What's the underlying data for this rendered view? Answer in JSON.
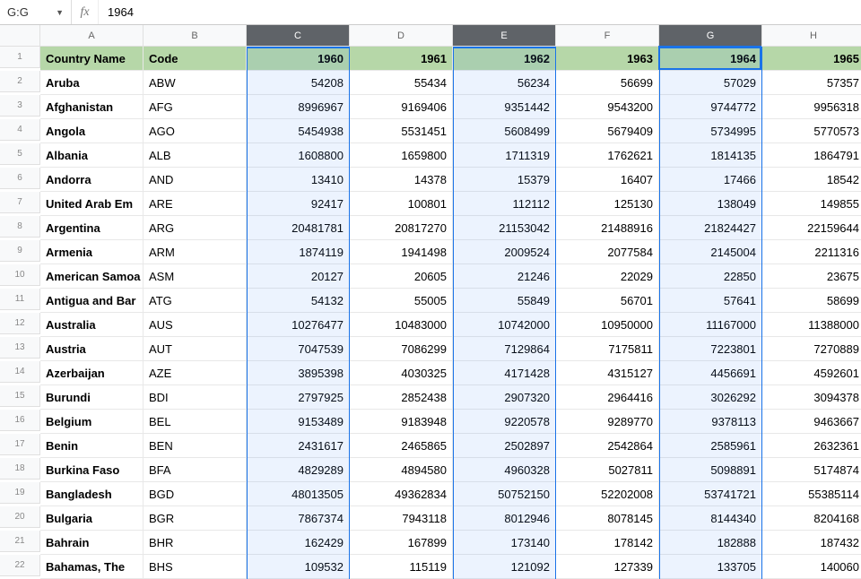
{
  "formula_bar": {
    "name_box": "G:G",
    "fx_label": "fx",
    "formula_value": "1964"
  },
  "columns": [
    "",
    "A",
    "B",
    "C",
    "D",
    "E",
    "F",
    "G",
    "H"
  ],
  "selected_columns": [
    "C",
    "E",
    "G"
  ],
  "active_column": "G",
  "active_row": 1,
  "header": {
    "country": "Country Name",
    "code": "Code",
    "years": [
      "1960",
      "1961",
      "1962",
      "1963",
      "1964",
      "1965"
    ]
  },
  "rows": [
    {
      "n": "2",
      "country": "Aruba",
      "code": "ABW",
      "v": [
        "54208",
        "55434",
        "56234",
        "56699",
        "57029",
        "57357"
      ]
    },
    {
      "n": "3",
      "country": "Afghanistan",
      "code": "AFG",
      "v": [
        "8996967",
        "9169406",
        "9351442",
        "9543200",
        "9744772",
        "9956318"
      ]
    },
    {
      "n": "4",
      "country": "Angola",
      "code": "AGO",
      "v": [
        "5454938",
        "5531451",
        "5608499",
        "5679409",
        "5734995",
        "5770573"
      ]
    },
    {
      "n": "5",
      "country": "Albania",
      "code": "ALB",
      "v": [
        "1608800",
        "1659800",
        "1711319",
        "1762621",
        "1814135",
        "1864791"
      ]
    },
    {
      "n": "6",
      "country": "Andorra",
      "code": "AND",
      "v": [
        "13410",
        "14378",
        "15379",
        "16407",
        "17466",
        "18542"
      ]
    },
    {
      "n": "7",
      "country": "United Arab Em",
      "code": "ARE",
      "v": [
        "92417",
        "100801",
        "112112",
        "125130",
        "138049",
        "149855"
      ]
    },
    {
      "n": "8",
      "country": "Argentina",
      "code": "ARG",
      "v": [
        "20481781",
        "20817270",
        "21153042",
        "21488916",
        "21824427",
        "22159644"
      ]
    },
    {
      "n": "9",
      "country": "Armenia",
      "code": "ARM",
      "v": [
        "1874119",
        "1941498",
        "2009524",
        "2077584",
        "2145004",
        "2211316"
      ]
    },
    {
      "n": "10",
      "country": "American Samoa",
      "code": "ASM",
      "v": [
        "20127",
        "20605",
        "21246",
        "22029",
        "22850",
        "23675"
      ]
    },
    {
      "n": "11",
      "country": "Antigua and Bar",
      "code": "ATG",
      "v": [
        "54132",
        "55005",
        "55849",
        "56701",
        "57641",
        "58699"
      ]
    },
    {
      "n": "12",
      "country": "Australia",
      "code": "AUS",
      "v": [
        "10276477",
        "10483000",
        "10742000",
        "10950000",
        "11167000",
        "11388000"
      ]
    },
    {
      "n": "13",
      "country": "Austria",
      "code": "AUT",
      "v": [
        "7047539",
        "7086299",
        "7129864",
        "7175811",
        "7223801",
        "7270889"
      ]
    },
    {
      "n": "14",
      "country": "Azerbaijan",
      "code": "AZE",
      "v": [
        "3895398",
        "4030325",
        "4171428",
        "4315127",
        "4456691",
        "4592601"
      ]
    },
    {
      "n": "15",
      "country": "Burundi",
      "code": "BDI",
      "v": [
        "2797925",
        "2852438",
        "2907320",
        "2964416",
        "3026292",
        "3094378"
      ]
    },
    {
      "n": "16",
      "country": "Belgium",
      "code": "BEL",
      "v": [
        "9153489",
        "9183948",
        "9220578",
        "9289770",
        "9378113",
        "9463667"
      ]
    },
    {
      "n": "17",
      "country": "Benin",
      "code": "BEN",
      "v": [
        "2431617",
        "2465865",
        "2502897",
        "2542864",
        "2585961",
        "2632361"
      ]
    },
    {
      "n": "18",
      "country": "Burkina Faso",
      "code": "BFA",
      "v": [
        "4829289",
        "4894580",
        "4960328",
        "5027811",
        "5098891",
        "5174874"
      ]
    },
    {
      "n": "19",
      "country": "Bangladesh",
      "code": "BGD",
      "v": [
        "48013505",
        "49362834",
        "50752150",
        "52202008",
        "53741721",
        "55385114"
      ]
    },
    {
      "n": "20",
      "country": "Bulgaria",
      "code": "BGR",
      "v": [
        "7867374",
        "7943118",
        "8012946",
        "8078145",
        "8144340",
        "8204168"
      ]
    },
    {
      "n": "21",
      "country": "Bahrain",
      "code": "BHR",
      "v": [
        "162429",
        "167899",
        "173140",
        "178142",
        "182888",
        "187432"
      ]
    },
    {
      "n": "22",
      "country": "Bahamas, The",
      "code": "BHS",
      "v": [
        "109532",
        "115119",
        "121092",
        "127339",
        "133705",
        "140060"
      ]
    }
  ]
}
